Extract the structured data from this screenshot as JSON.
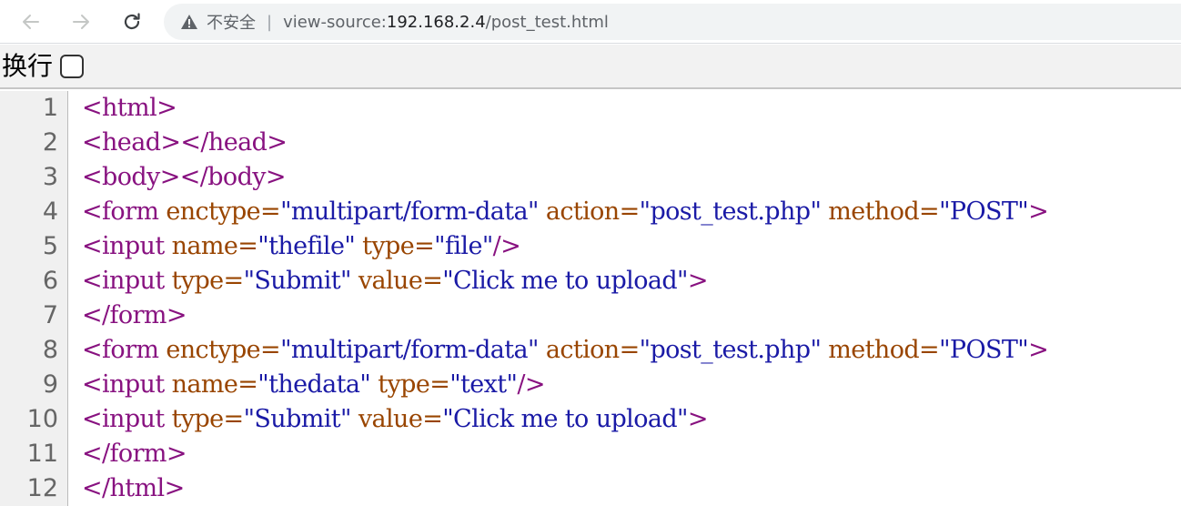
{
  "browser": {
    "security_label": "不安全",
    "separator": "|",
    "url_scheme": "view-source:",
    "url_host": "192.168.2.4",
    "url_path": "/post_test.html"
  },
  "wrap": {
    "label": "换行",
    "checked": false
  },
  "colors": {
    "tag": "#881280",
    "attribute": "#994500",
    "value": "#1a1aa6"
  },
  "source_lines": [
    {
      "number": "1",
      "tokens": [
        {
          "t": "tag",
          "v": "<html>"
        }
      ]
    },
    {
      "number": "2",
      "tokens": [
        {
          "t": "tag",
          "v": "<head></head>"
        }
      ]
    },
    {
      "number": "3",
      "tokens": [
        {
          "t": "tag",
          "v": "<body></body>"
        }
      ]
    },
    {
      "number": "4",
      "tokens": [
        {
          "t": "tag",
          "v": "<form "
        },
        {
          "t": "attr",
          "v": "enctype="
        },
        {
          "t": "val",
          "v": "\"multipart/form-data\""
        },
        {
          "t": "tag",
          "v": " "
        },
        {
          "t": "attr",
          "v": "action="
        },
        {
          "t": "val",
          "v": "\"post_test.php\""
        },
        {
          "t": "tag",
          "v": " "
        },
        {
          "t": "attr",
          "v": "method="
        },
        {
          "t": "val",
          "v": "\"POST\""
        },
        {
          "t": "tag",
          "v": ">"
        }
      ]
    },
    {
      "number": "5",
      "tokens": [
        {
          "t": "tag",
          "v": "<input "
        },
        {
          "t": "attr",
          "v": "name="
        },
        {
          "t": "val",
          "v": "\"thefile\""
        },
        {
          "t": "tag",
          "v": " "
        },
        {
          "t": "attr",
          "v": "type="
        },
        {
          "t": "val",
          "v": "\"file\""
        },
        {
          "t": "tag",
          "v": "/>"
        }
      ]
    },
    {
      "number": "6",
      "tokens": [
        {
          "t": "tag",
          "v": "<input "
        },
        {
          "t": "attr",
          "v": "type="
        },
        {
          "t": "val",
          "v": "\"Submit\""
        },
        {
          "t": "tag",
          "v": " "
        },
        {
          "t": "attr",
          "v": "value="
        },
        {
          "t": "val",
          "v": "\"Click me to upload\""
        },
        {
          "t": "tag",
          "v": ">"
        }
      ]
    },
    {
      "number": "7",
      "tokens": [
        {
          "t": "tag",
          "v": "</form>"
        }
      ]
    },
    {
      "number": "8",
      "tokens": [
        {
          "t": "tag",
          "v": "<form "
        },
        {
          "t": "attr",
          "v": "enctype="
        },
        {
          "t": "val",
          "v": "\"multipart/form-data\""
        },
        {
          "t": "tag",
          "v": " "
        },
        {
          "t": "attr",
          "v": "action="
        },
        {
          "t": "val",
          "v": "\"post_test.php\""
        },
        {
          "t": "tag",
          "v": " "
        },
        {
          "t": "attr",
          "v": "method="
        },
        {
          "t": "val",
          "v": "\"POST\""
        },
        {
          "t": "tag",
          "v": ">"
        }
      ]
    },
    {
      "number": "9",
      "tokens": [
        {
          "t": "tag",
          "v": "<input "
        },
        {
          "t": "attr",
          "v": "name="
        },
        {
          "t": "val",
          "v": "\"thedata\""
        },
        {
          "t": "tag",
          "v": " "
        },
        {
          "t": "attr",
          "v": "type="
        },
        {
          "t": "val",
          "v": "\"text\""
        },
        {
          "t": "tag",
          "v": "/>"
        }
      ]
    },
    {
      "number": "10",
      "tokens": [
        {
          "t": "tag",
          "v": "<input "
        },
        {
          "t": "attr",
          "v": "type="
        },
        {
          "t": "val",
          "v": "\"Submit\""
        },
        {
          "t": "tag",
          "v": " "
        },
        {
          "t": "attr",
          "v": "value="
        },
        {
          "t": "val",
          "v": "\"Click me to upload\""
        },
        {
          "t": "tag",
          "v": ">"
        }
      ]
    },
    {
      "number": "11",
      "tokens": [
        {
          "t": "tag",
          "v": "</form>"
        }
      ]
    },
    {
      "number": "12",
      "tokens": [
        {
          "t": "tag",
          "v": "</html>"
        }
      ]
    }
  ]
}
